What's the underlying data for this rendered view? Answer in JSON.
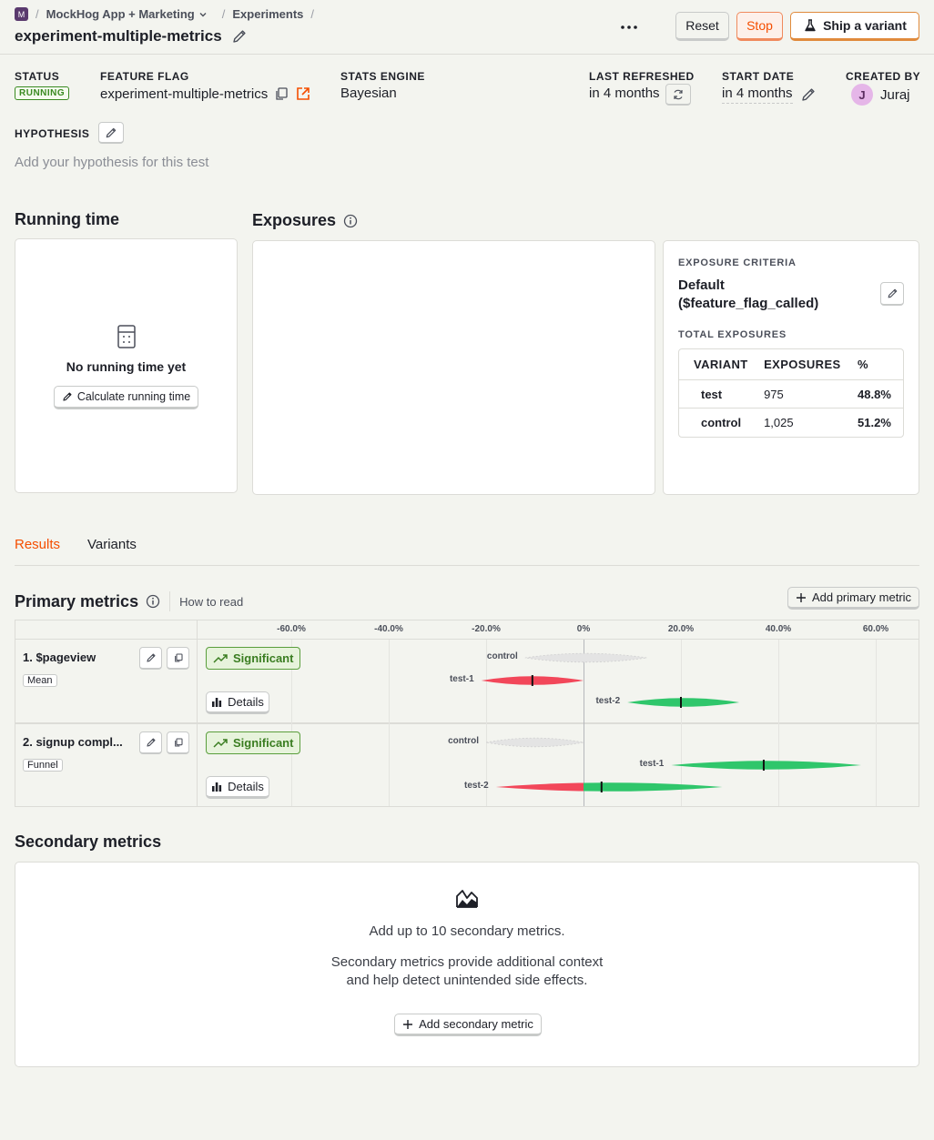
{
  "breadcrumb": {
    "project_initial": "M",
    "project": "MockHog App + Marketing",
    "section": "Experiments"
  },
  "experiment": {
    "name": "experiment-multiple-metrics"
  },
  "header_actions": {
    "reset": "Reset",
    "stop": "Stop",
    "ship": "Ship a variant"
  },
  "meta": {
    "status_label": "STATUS",
    "status_value": "RUNNING",
    "flag_label": "FEATURE FLAG",
    "flag_value": "experiment-multiple-metrics",
    "engine_label": "STATS ENGINE",
    "engine_value": "Bayesian",
    "refreshed_label": "LAST REFRESHED",
    "refreshed_value": "in 4 months",
    "start_label": "START DATE",
    "start_value": "in 4 months",
    "created_label": "CREATED BY",
    "created_initial": "J",
    "created_value": "Juraj"
  },
  "hypothesis": {
    "label": "HYPOTHESIS",
    "placeholder": "Add your hypothesis for this test"
  },
  "running_time": {
    "title": "Running time",
    "empty": "No running time yet",
    "button": "Calculate running time"
  },
  "exposures": {
    "title": "Exposures",
    "criteria_label": "EXPOSURE CRITERIA",
    "criteria_value": "Default ($feature_flag_called)",
    "total_label": "TOTAL EXPOSURES",
    "columns": [
      "VARIANT",
      "EXPOSURES",
      "%"
    ],
    "rows": [
      {
        "variant": "test",
        "exposures": "975",
        "pct": "48.8%"
      },
      {
        "variant": "control",
        "exposures": "1,025",
        "pct": "51.2%"
      }
    ]
  },
  "tabs": [
    "Results",
    "Variants"
  ],
  "primary": {
    "title": "Primary metrics",
    "how_to_read": "How to read",
    "add_button": "Add primary metric",
    "axis_ticks": [
      "-60.0%",
      "-40.0%",
      "-20.0%",
      "0%",
      "20.0%",
      "40.0%",
      "60.0%"
    ],
    "significant_label": "Significant",
    "details_label": "Details"
  },
  "chart_data": {
    "type": "violin-intervals",
    "x_axis": {
      "unit": "%",
      "ticks": [
        -60,
        -40,
        -20,
        0,
        20,
        40,
        60
      ]
    },
    "metrics": [
      {
        "title": "1. $pageview",
        "type_tag": "Mean",
        "status": "Significant",
        "variants": [
          {
            "name": "control",
            "low": -12,
            "high": 13,
            "point": 0,
            "color": "#d8d8d8"
          },
          {
            "name": "test-1",
            "low": -21,
            "high": 0,
            "point": -10.5,
            "color": "#f2475a"
          },
          {
            "name": "test-2",
            "low": 9,
            "high": 32,
            "point": 20,
            "color": "#2fc66b"
          }
        ]
      },
      {
        "title": "2. signup compl...",
        "type_tag": "Funnel",
        "status": "Significant",
        "variants": [
          {
            "name": "control",
            "low": -20,
            "high": 0,
            "point": 0,
            "color": "#d8d8d8"
          },
          {
            "name": "test-1",
            "low": 18,
            "high": 57,
            "point": 37,
            "color": "#2fc66b"
          },
          {
            "name": "test-2",
            "low": -18,
            "high": 28.5,
            "point": 3.7,
            "color": "#f2475a",
            "color_pos": "#2fc66b"
          }
        ]
      }
    ]
  },
  "secondary": {
    "title": "Secondary metrics",
    "headline": "Add up to 10 secondary metrics.",
    "description_1": "Secondary metrics provide additional context",
    "description_2": "and help detect unintended side effects.",
    "button": "Add secondary metric"
  },
  "colors": {
    "accent": "#f54e00",
    "bg": "#f3f4ef",
    "success": "#3a8a21",
    "negative": "#f2475a",
    "positive": "#2fc66b"
  }
}
